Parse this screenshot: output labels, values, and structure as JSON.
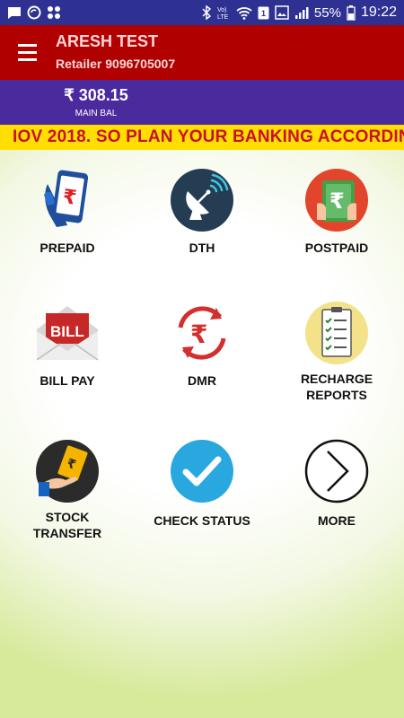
{
  "status_bar": {
    "battery_percent": "55%",
    "time": "19:22",
    "icons": [
      "message-icon",
      "sync-icon",
      "apps-icon",
      "bluetooth-icon",
      "volte-icon",
      "wifi-icon",
      "sim-icon",
      "gallery-icon",
      "signal-icon",
      "battery-icon"
    ]
  },
  "header": {
    "title": "ARESH TEST",
    "subtitle": "Retailer 9096705007"
  },
  "balance": {
    "amount": "₹ 308.15",
    "label": "MAIN BAL"
  },
  "ticker": {
    "text": "IOV 2018. SO PLAN YOUR BANKING ACCORDIN"
  },
  "menu": [
    {
      "label": "PREPAID",
      "icon": "mobile-rupee-icon"
    },
    {
      "label": "DTH",
      "icon": "satellite-dish-icon"
    },
    {
      "label": "POSTPAID",
      "icon": "rupee-note-icon"
    },
    {
      "label": "BILL PAY",
      "icon": "bill-envelope-icon"
    },
    {
      "label": "DMR",
      "icon": "rupee-refresh-icon"
    },
    {
      "label_line1": "RECHARGE",
      "label_line2": "REPORTS",
      "icon": "checklist-icon"
    },
    {
      "label_line1": "STOCK",
      "label_line2": "TRANSFER",
      "icon": "hand-money-icon"
    },
    {
      "label": "CHECK STATUS",
      "icon": "checkmark-icon"
    },
    {
      "label": "MORE",
      "icon": "chevron-right-icon"
    }
  ],
  "colors": {
    "status_bar": "#2e3192",
    "header": "#b00000",
    "balance_bar": "#4b2a9e",
    "ticker_bg": "#ffde00",
    "ticker_text": "#c8102e"
  }
}
